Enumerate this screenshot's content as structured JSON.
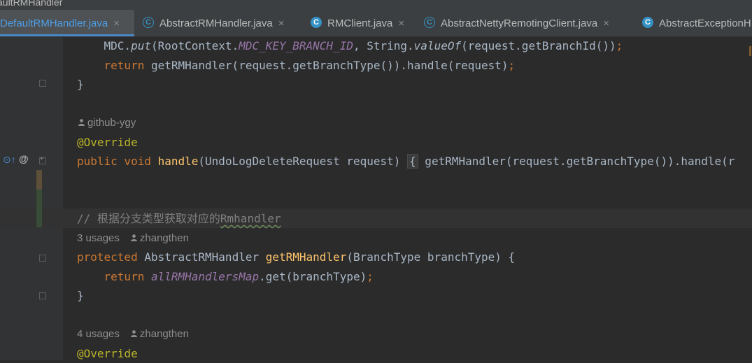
{
  "title_strip": {
    "text": "aultRMHandler"
  },
  "tabs": [
    {
      "label": "DefaultRMHandler.java",
      "close": "×",
      "active": true
    },
    {
      "label": "AbstractRMHandler.java",
      "close": "×",
      "icon": "C"
    },
    {
      "label": "RMClient.java",
      "close": "×",
      "icon": "C"
    },
    {
      "label": "AbstractNettyRemotingClient.java",
      "close": "×",
      "icon": "C"
    },
    {
      "label": "AbstractExceptionH",
      "icon": "C"
    }
  ],
  "gutter": {
    "override_icon": "⊙↑",
    "at_icon": "@"
  },
  "code": {
    "l1_a": "    MDC.",
    "l1_b": "put",
    "l1_c": "(RootContext.",
    "l1_d": "MDC_KEY_BRANCH_ID",
    "l1_e": ", String.",
    "l1_f": "valueOf",
    "l1_g": "(request.getBranchId())",
    "l1_h": ";",
    "l2_kw": "    return",
    "l2_rest": " getRMHandler(request.getBranchType()).handle(request)",
    "l2_semi": ";",
    "l3": "}",
    "h1": "github-ygy",
    "l4": "@Override",
    "l5_kw1": "public",
    "l5_kw2": " void",
    "l5_fn": " handle",
    "l5_rest": "(UndoLogDeleteRequest request) ",
    "l5_brace": "{",
    "l5_tail": " getRMHandler(request.getBranchType()).handle(r",
    "l6_comment": "// 根据分支类型获取对应的",
    "l6_word": "Rmhandler",
    "h2_usages": "3 usages",
    "h2_author": "zhangthen",
    "l7_kw": "protected",
    "l7_type": " AbstractRMHandler",
    "l7_fn": " getRMHandler",
    "l7_rest": "(BranchType branchType) {",
    "l8_kw": "    return",
    "l8_field": " allRMHandlersMap",
    "l8_rest": ".get(branchType)",
    "l8_semi": ";",
    "l9": "}",
    "h3_usages": "4 usages",
    "h3_author": "zhangthen",
    "l10": "@Override"
  }
}
